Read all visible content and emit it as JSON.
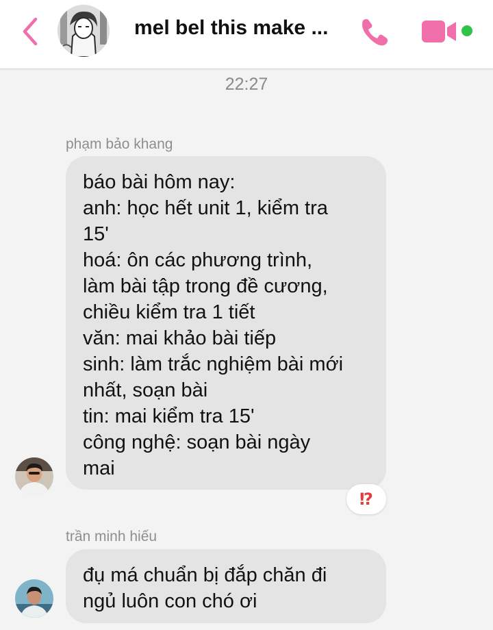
{
  "header": {
    "title": "mel bel this make ...",
    "back_icon": "chevron-left-icon",
    "call_icon": "phone-icon",
    "video_icon": "video-camera-icon",
    "online_status": "online",
    "accent_color": "#f06ea9",
    "online_color": "#31c24a"
  },
  "conversation": {
    "timestamp": "22:27",
    "messages": [
      {
        "sender": "phạm bảo khang",
        "text": "báo bài hôm nay:\nanh: học hết unit 1, kiểm tra\n15'\nhoá: ôn các phương trình,\nlàm bài tập trong đề cương,\nchiều kiểm tra 1 tiết\nvăn: mai khảo bài tiếp\nsinh: làm trắc nghiệm bài mới\nnhất, soạn bài\ntin: mai kiểm tra 15'\ncông nghệ: soạn bài ngày\nmai",
        "reaction": "⁉"
      },
      {
        "sender": "trần minh hiếu",
        "text": "đụ má chuẩn bị đắp chăn đi\nngủ luôn con chó ơi"
      }
    ]
  }
}
